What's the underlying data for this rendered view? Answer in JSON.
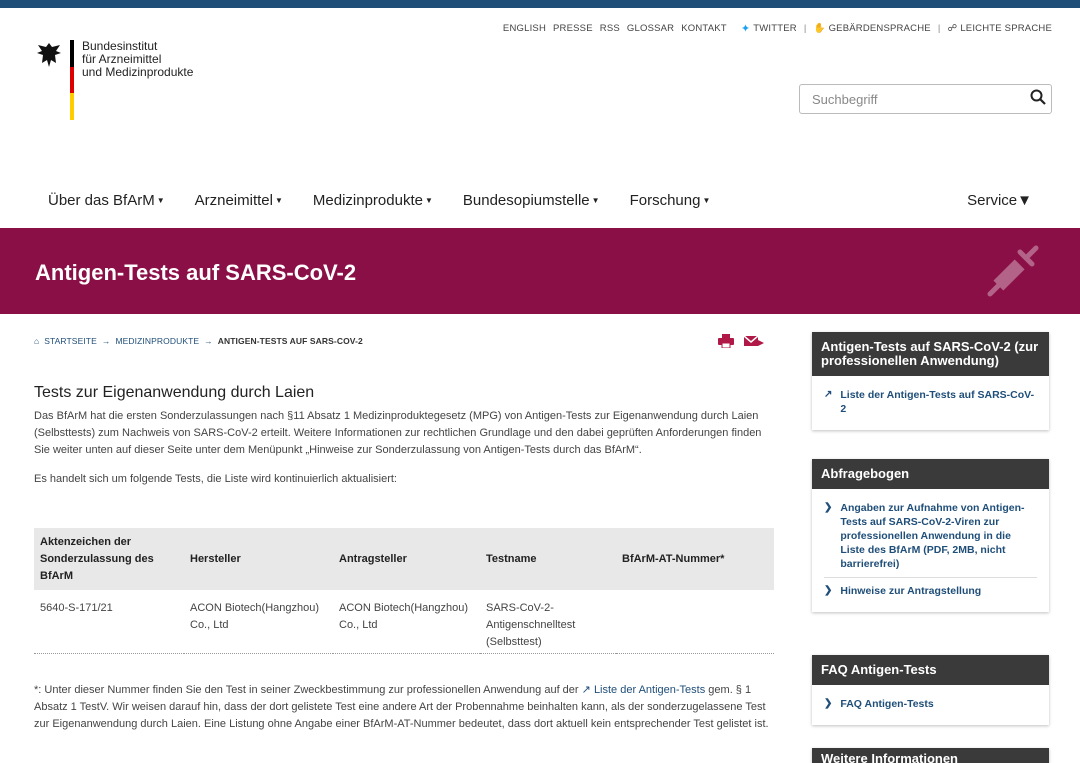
{
  "colors": {
    "brand": "#8b0f47",
    "link": "#1f4e79",
    "topbar": "#1f4e79",
    "sidebar_header": "#3a3a3a"
  },
  "toplinks": {
    "english": "ENGLISH",
    "presse": "PRESSE",
    "rss": "RSS",
    "glossar": "GLOSSAR",
    "kontakt": "KONTAKT",
    "twitter": "TWITTER",
    "gebaerden": "GEBÄRDENSPRACHE",
    "leichte": "LEICHTE SPRACHE"
  },
  "logo": {
    "line1": "Bundesinstitut",
    "line2": "für Arzneimittel",
    "line3": "und Medizinprodukte"
  },
  "search": {
    "placeholder": "Suchbegriff"
  },
  "nav": {
    "items": [
      "Über das BfArM",
      "Arzneimittel",
      "Medizinprodukte",
      "Bundesopiumstelle",
      "Forschung"
    ],
    "service": "Service"
  },
  "banner": {
    "title": "Antigen-Tests auf SARS-CoV-2"
  },
  "breadcrumb": {
    "home": "STARTSEITE",
    "section": "MEDIZINPRODUKTE",
    "current": "ANTIGEN-TESTS AUF SARS-COV-2"
  },
  "main": {
    "heading": "Tests zur Eigenanwendung durch Laien",
    "intro": "Das BfArM hat die ersten Sonderzulassungen nach §11 Absatz 1 Medizinproduktegesetz (MPG) von Antigen-Tests zur Eigenanwendung durch Laien (Selbsttests) zum Nachweis von SARS-CoV-2 erteilt. Weitere Informationen zur rechtlichen Grundlage und den dabei geprüften Anforderungen finden Sie weiter unten auf dieser Seite unter dem Menüpunkt „Hinweise zur Sonderzulassung von Antigen-Tests durch das BfArM“.",
    "list_note": "Es handelt sich um folgende Tests, die Liste wird kontinuierlich aktualisiert:"
  },
  "table": {
    "headers": [
      "Aktenzeichen der Sonderzulassung des BfArM",
      "Hersteller",
      "Antragsteller",
      "Testname",
      "BfArM-AT-Nummer*"
    ],
    "rows": [
      [
        "5640-S-171/21",
        "ACON Biotech(Hangzhou) Co., Ltd",
        "ACON Biotech(Hangzhou) Co., Ltd",
        "SARS-CoV-2-Antigenschnelltest (Selbsttest)",
        ""
      ]
    ]
  },
  "footnote": {
    "before": "*: Unter dieser Nummer finden Sie den Test in seiner Zweckbestimmung zur professionellen Anwendung auf der",
    "link": "Liste der Antigen-Tests",
    "after": "gem. § 1 Absatz 1 TestV. Wir weisen darauf hin, dass der dort gelistete Test eine andere Art der Probennahme beinhalten kann, als der sonderzugelassene Test zur Eigenanwendung durch Laien. Eine Listung ohne Angabe einer BfArM-AT-Nummer bedeutet, dass dort aktuell kein entsprechender Test gelistet ist."
  },
  "sidebar": {
    "box1": {
      "title": "Antigen-Tests auf SARS-CoV-2 (zur professionellen Anwendung)",
      "items": [
        "Liste der Antigen-Tests auf SARS-CoV-2"
      ]
    },
    "box2": {
      "title": "Abfragebogen",
      "items": [
        "Angaben zur Aufnahme von Antigen-Tests auf SARS-CoV-2-Viren zur professionellen Anwendung in die Liste des BfArM (PDF, 2MB, nicht barrierefrei)",
        "Hinweise zur Antragstellung"
      ]
    },
    "box3": {
      "title": "FAQ Antigen-Tests",
      "items": [
        "FAQ Antigen-Tests"
      ]
    },
    "box4": {
      "title": "Weitere Informationen"
    }
  }
}
